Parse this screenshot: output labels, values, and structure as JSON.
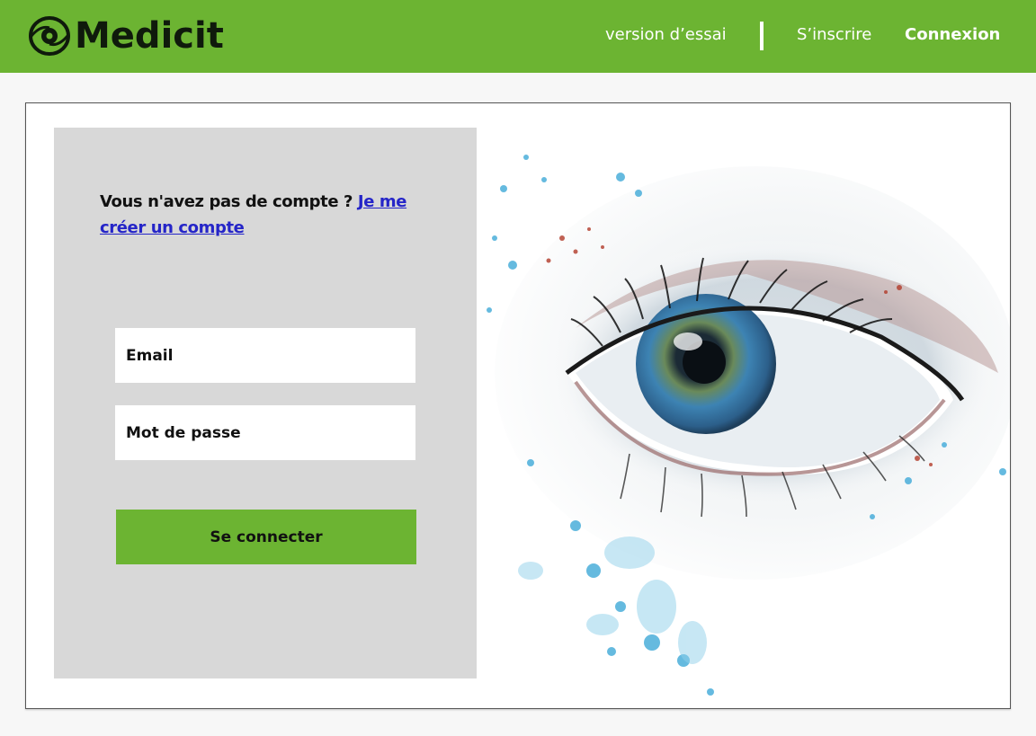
{
  "brand": {
    "name": "Medicit"
  },
  "nav": {
    "trial_label": "version d’essai",
    "signup_label": "S’inscrire",
    "login_label": "Connexion"
  },
  "login": {
    "prompt_text": "Vous n'avez pas de compte ?",
    "create_link": "Je me créer un compte",
    "email_placeholder": "Email",
    "password_placeholder": "Mot de passe",
    "submit_label": "Se connecter"
  },
  "colors": {
    "brand_green": "#6cb432",
    "panel_gray": "#d8d8d8",
    "link_blue": "#2525c8"
  },
  "illustration": {
    "icon": "watercolor-eye-illustration"
  }
}
